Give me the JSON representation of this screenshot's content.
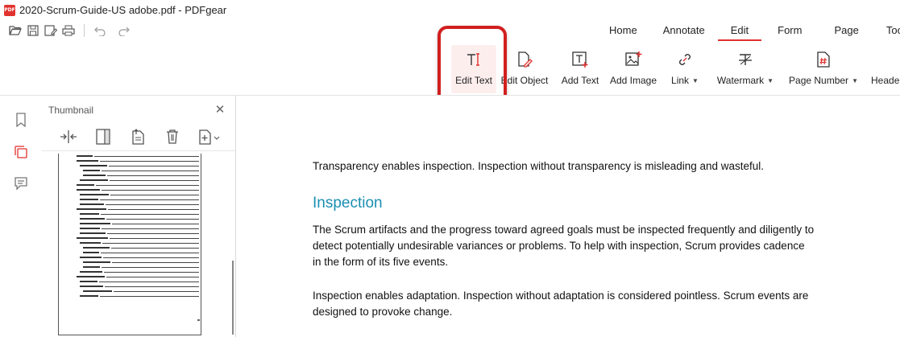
{
  "window": {
    "title": "2020-Scrum-Guide-US adobe.pdf - PDFgear",
    "logo_text": "PDF"
  },
  "quickbar": {
    "icons": [
      "open-folder-icon",
      "save-icon",
      "save-as-icon",
      "print-icon",
      "undo-icon",
      "redo-icon"
    ]
  },
  "menu": {
    "tabs": [
      {
        "label": "Home"
      },
      {
        "label": "Annotate"
      },
      {
        "label": "Edit",
        "active": true
      },
      {
        "label": "Form"
      },
      {
        "label": "Page"
      },
      {
        "label": "Tools"
      }
    ]
  },
  "ribbon": {
    "edit_text": "Edit Text",
    "edit_object": "Edit Object",
    "add_text": "Add Text",
    "add_image": "Add Image",
    "link": "Link",
    "watermark": "Watermark",
    "page_number": "Page Number",
    "header": "Heade",
    "dropdown_caret": "▼"
  },
  "colors": {
    "accent": "#e0322e",
    "highlight_box": "#d21f1f",
    "heading": "#1b8fb3",
    "selected_bg": "#fdeeee"
  },
  "thumbnail_panel": {
    "title": "Thumbnail",
    "close_glyph": "✕"
  },
  "document": {
    "para1": "Transparency enables inspection. Inspection without transparency is misleading and wasteful.",
    "heading": "Inspection",
    "para2_lines": [
      "The Scrum artifacts and the progress toward agreed goals must be inspected frequently and diligently to",
      "detect potentially undesirable variances or problems. To help with inspection, Scrum provides cadence",
      "in the form of its five events."
    ],
    "para3_lines": [
      "Inspection enables adaptation. Inspection without adaptation is considered pointless. Scrum events are",
      "designed to provoke change."
    ]
  }
}
